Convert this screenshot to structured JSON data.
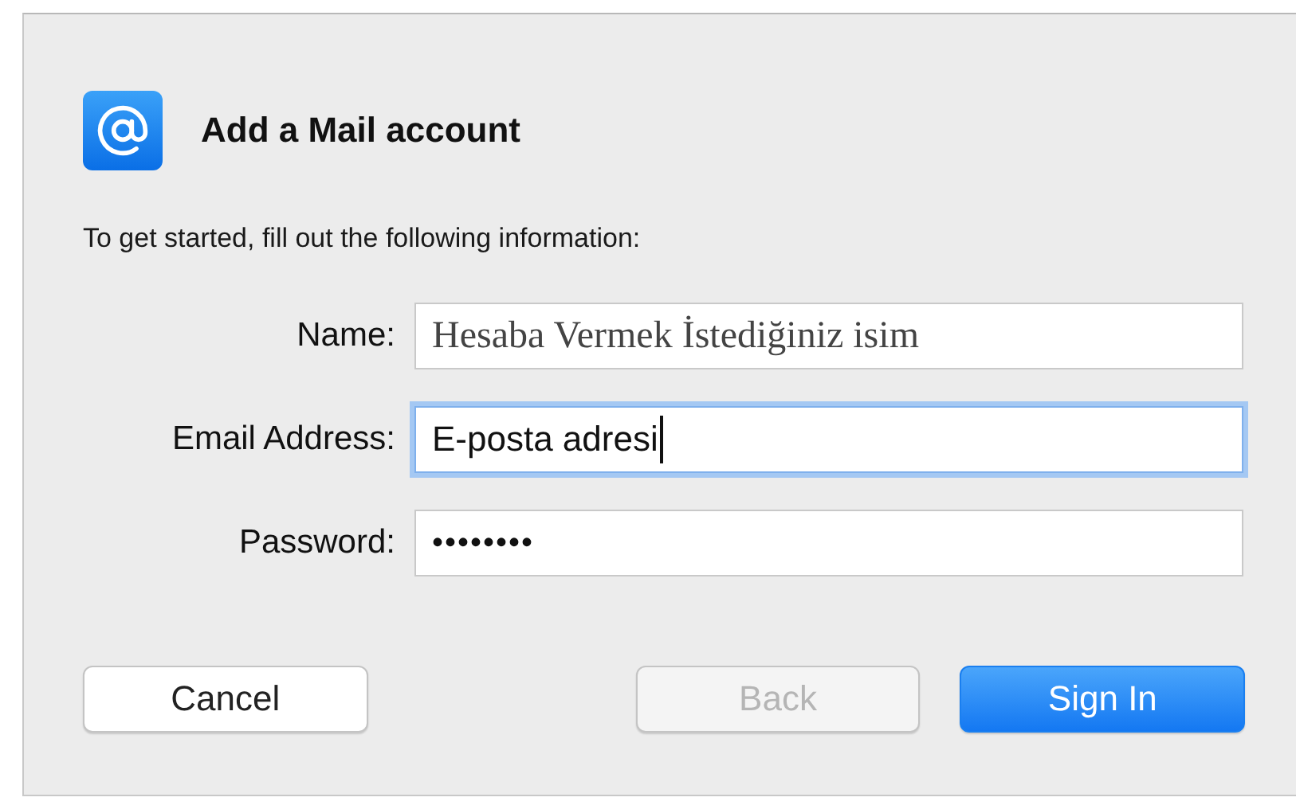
{
  "dialog": {
    "title": "Add a Mail account",
    "intro": "To get started, fill out the following information:"
  },
  "fields": [
    {
      "label": "Name:",
      "kind": "serif",
      "value": "Hesaba Vermek İstediğiniz isim",
      "focused": false
    },
    {
      "label": "Email Address:",
      "kind": "text",
      "value": "E-posta adresi",
      "focused": true
    },
    {
      "label": "Password:",
      "kind": "password",
      "value": "••••••••",
      "focused": false
    }
  ],
  "buttons": [
    {
      "label": "Cancel",
      "kind": "plain",
      "disabled": false
    },
    {
      "label": "Back",
      "kind": "plain",
      "disabled": true
    },
    {
      "label": "Sign In",
      "kind": "default",
      "disabled": false
    }
  ]
}
